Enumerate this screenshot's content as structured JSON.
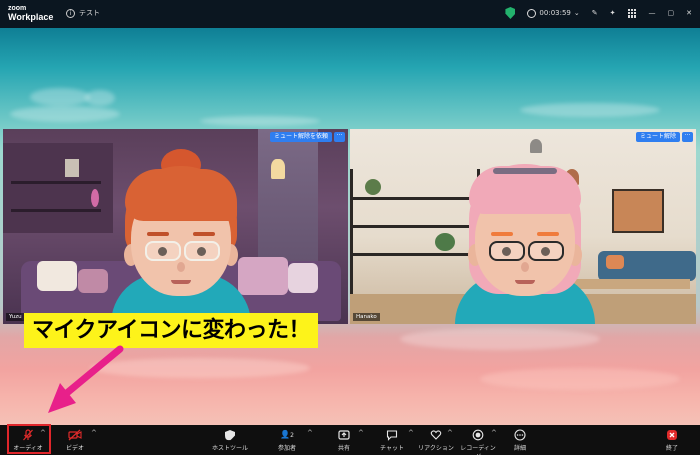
{
  "titlebar": {
    "logo_line1": "zoom",
    "logo_line2": "Workplace",
    "meeting_name": "テスト",
    "timer": "00:03:59"
  },
  "tiles": [
    {
      "name": "Yuzu",
      "mute_label": "ミュート解除を依頼",
      "more": "···"
    },
    {
      "name": "Hanako",
      "mute_label": "ミュート解除",
      "more": "···"
    }
  ],
  "callout": {
    "text": "マイクアイコンに変わった！"
  },
  "toolbar": {
    "audio": "オーディオ",
    "video": "ビデオ",
    "host_tools": "ホストツール",
    "participants": "参加者",
    "participants_count": "2",
    "share": "共有",
    "chat": "チャット",
    "reactions": "リアクション",
    "recording": "レコーディング",
    "more": "詳細",
    "end": "終了"
  },
  "colors": {
    "accent_blue": "#2f7ef0",
    "callout_yellow": "#fdf31a",
    "arrow_pink": "#e8208a",
    "highlight_red": "#e0262b",
    "shield_green": "#23b26d"
  }
}
